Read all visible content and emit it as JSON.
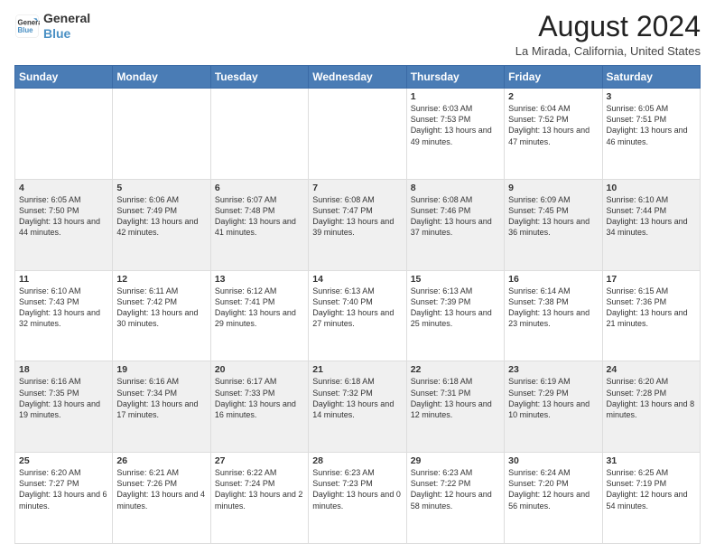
{
  "logo": {
    "line1": "General",
    "line2": "Blue"
  },
  "header": {
    "month_year": "August 2024",
    "location": "La Mirada, California, United States"
  },
  "days_of_week": [
    "Sunday",
    "Monday",
    "Tuesday",
    "Wednesday",
    "Thursday",
    "Friday",
    "Saturday"
  ],
  "weeks": [
    [
      {
        "day": "",
        "sunrise": "",
        "sunset": "",
        "daylight": ""
      },
      {
        "day": "",
        "sunrise": "",
        "sunset": "",
        "daylight": ""
      },
      {
        "day": "",
        "sunrise": "",
        "sunset": "",
        "daylight": ""
      },
      {
        "day": "",
        "sunrise": "",
        "sunset": "",
        "daylight": ""
      },
      {
        "day": "1",
        "sunrise": "Sunrise: 6:03 AM",
        "sunset": "Sunset: 7:53 PM",
        "daylight": "Daylight: 13 hours and 49 minutes."
      },
      {
        "day": "2",
        "sunrise": "Sunrise: 6:04 AM",
        "sunset": "Sunset: 7:52 PM",
        "daylight": "Daylight: 13 hours and 47 minutes."
      },
      {
        "day": "3",
        "sunrise": "Sunrise: 6:05 AM",
        "sunset": "Sunset: 7:51 PM",
        "daylight": "Daylight: 13 hours and 46 minutes."
      }
    ],
    [
      {
        "day": "4",
        "sunrise": "Sunrise: 6:05 AM",
        "sunset": "Sunset: 7:50 PM",
        "daylight": "Daylight: 13 hours and 44 minutes."
      },
      {
        "day": "5",
        "sunrise": "Sunrise: 6:06 AM",
        "sunset": "Sunset: 7:49 PM",
        "daylight": "Daylight: 13 hours and 42 minutes."
      },
      {
        "day": "6",
        "sunrise": "Sunrise: 6:07 AM",
        "sunset": "Sunset: 7:48 PM",
        "daylight": "Daylight: 13 hours and 41 minutes."
      },
      {
        "day": "7",
        "sunrise": "Sunrise: 6:08 AM",
        "sunset": "Sunset: 7:47 PM",
        "daylight": "Daylight: 13 hours and 39 minutes."
      },
      {
        "day": "8",
        "sunrise": "Sunrise: 6:08 AM",
        "sunset": "Sunset: 7:46 PM",
        "daylight": "Daylight: 13 hours and 37 minutes."
      },
      {
        "day": "9",
        "sunrise": "Sunrise: 6:09 AM",
        "sunset": "Sunset: 7:45 PM",
        "daylight": "Daylight: 13 hours and 36 minutes."
      },
      {
        "day": "10",
        "sunrise": "Sunrise: 6:10 AM",
        "sunset": "Sunset: 7:44 PM",
        "daylight": "Daylight: 13 hours and 34 minutes."
      }
    ],
    [
      {
        "day": "11",
        "sunrise": "Sunrise: 6:10 AM",
        "sunset": "Sunset: 7:43 PM",
        "daylight": "Daylight: 13 hours and 32 minutes."
      },
      {
        "day": "12",
        "sunrise": "Sunrise: 6:11 AM",
        "sunset": "Sunset: 7:42 PM",
        "daylight": "Daylight: 13 hours and 30 minutes."
      },
      {
        "day": "13",
        "sunrise": "Sunrise: 6:12 AM",
        "sunset": "Sunset: 7:41 PM",
        "daylight": "Daylight: 13 hours and 29 minutes."
      },
      {
        "day": "14",
        "sunrise": "Sunrise: 6:13 AM",
        "sunset": "Sunset: 7:40 PM",
        "daylight": "Daylight: 13 hours and 27 minutes."
      },
      {
        "day": "15",
        "sunrise": "Sunrise: 6:13 AM",
        "sunset": "Sunset: 7:39 PM",
        "daylight": "Daylight: 13 hours and 25 minutes."
      },
      {
        "day": "16",
        "sunrise": "Sunrise: 6:14 AM",
        "sunset": "Sunset: 7:38 PM",
        "daylight": "Daylight: 13 hours and 23 minutes."
      },
      {
        "day": "17",
        "sunrise": "Sunrise: 6:15 AM",
        "sunset": "Sunset: 7:36 PM",
        "daylight": "Daylight: 13 hours and 21 minutes."
      }
    ],
    [
      {
        "day": "18",
        "sunrise": "Sunrise: 6:16 AM",
        "sunset": "Sunset: 7:35 PM",
        "daylight": "Daylight: 13 hours and 19 minutes."
      },
      {
        "day": "19",
        "sunrise": "Sunrise: 6:16 AM",
        "sunset": "Sunset: 7:34 PM",
        "daylight": "Daylight: 13 hours and 17 minutes."
      },
      {
        "day": "20",
        "sunrise": "Sunrise: 6:17 AM",
        "sunset": "Sunset: 7:33 PM",
        "daylight": "Daylight: 13 hours and 16 minutes."
      },
      {
        "day": "21",
        "sunrise": "Sunrise: 6:18 AM",
        "sunset": "Sunset: 7:32 PM",
        "daylight": "Daylight: 13 hours and 14 minutes."
      },
      {
        "day": "22",
        "sunrise": "Sunrise: 6:18 AM",
        "sunset": "Sunset: 7:31 PM",
        "daylight": "Daylight: 13 hours and 12 minutes."
      },
      {
        "day": "23",
        "sunrise": "Sunrise: 6:19 AM",
        "sunset": "Sunset: 7:29 PM",
        "daylight": "Daylight: 13 hours and 10 minutes."
      },
      {
        "day": "24",
        "sunrise": "Sunrise: 6:20 AM",
        "sunset": "Sunset: 7:28 PM",
        "daylight": "Daylight: 13 hours and 8 minutes."
      }
    ],
    [
      {
        "day": "25",
        "sunrise": "Sunrise: 6:20 AM",
        "sunset": "Sunset: 7:27 PM",
        "daylight": "Daylight: 13 hours and 6 minutes."
      },
      {
        "day": "26",
        "sunrise": "Sunrise: 6:21 AM",
        "sunset": "Sunset: 7:26 PM",
        "daylight": "Daylight: 13 hours and 4 minutes."
      },
      {
        "day": "27",
        "sunrise": "Sunrise: 6:22 AM",
        "sunset": "Sunset: 7:24 PM",
        "daylight": "Daylight: 13 hours and 2 minutes."
      },
      {
        "day": "28",
        "sunrise": "Sunrise: 6:23 AM",
        "sunset": "Sunset: 7:23 PM",
        "daylight": "Daylight: 13 hours and 0 minutes."
      },
      {
        "day": "29",
        "sunrise": "Sunrise: 6:23 AM",
        "sunset": "Sunset: 7:22 PM",
        "daylight": "Daylight: 12 hours and 58 minutes."
      },
      {
        "day": "30",
        "sunrise": "Sunrise: 6:24 AM",
        "sunset": "Sunset: 7:20 PM",
        "daylight": "Daylight: 12 hours and 56 minutes."
      },
      {
        "day": "31",
        "sunrise": "Sunrise: 6:25 AM",
        "sunset": "Sunset: 7:19 PM",
        "daylight": "Daylight: 12 hours and 54 minutes."
      }
    ]
  ]
}
